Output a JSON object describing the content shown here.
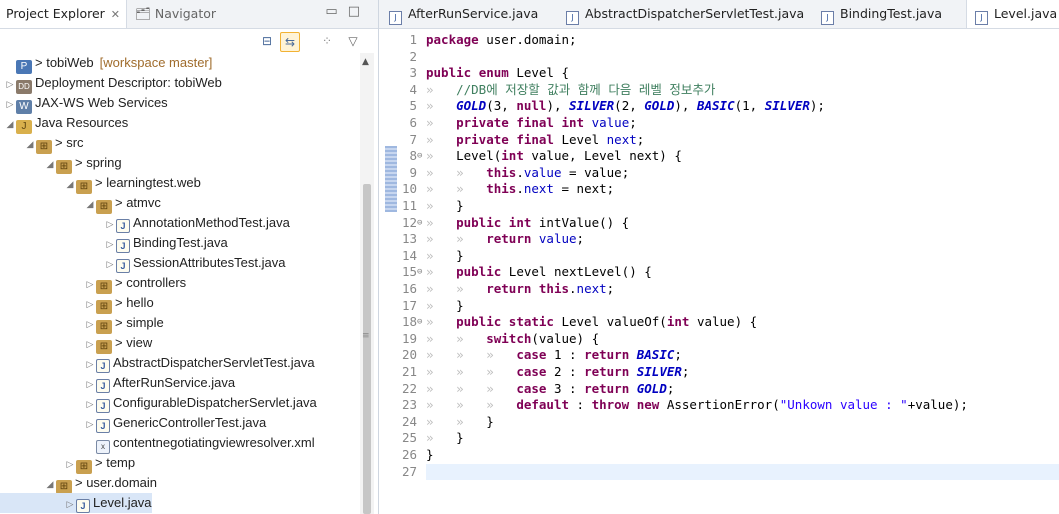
{
  "left_panel": {
    "tab_active": "Project Explorer",
    "tab_inactive": "Navigator",
    "tree": [
      {
        "indent": 0,
        "twisty": "",
        "icon": "proj",
        "text": "> tobiWeb",
        "suffix": "[workspace master]"
      },
      {
        "indent": 0,
        "twisty": "▷",
        "icon": "dd",
        "text": "Deployment Descriptor: tobiWeb"
      },
      {
        "indent": 0,
        "twisty": "▷",
        "icon": "ws",
        "text": "JAX-WS Web Services"
      },
      {
        "indent": 0,
        "twisty": "◢",
        "icon": "jr",
        "text": "Java Resources"
      },
      {
        "indent": 1,
        "twisty": "◢",
        "icon": "pkg",
        "text": "> src"
      },
      {
        "indent": 2,
        "twisty": "◢",
        "icon": "pkg",
        "text": "> spring"
      },
      {
        "indent": 3,
        "twisty": "◢",
        "icon": "pkg",
        "text": "> learningtest.web"
      },
      {
        "indent": 4,
        "twisty": "◢",
        "icon": "pkg",
        "text": "> atmvc"
      },
      {
        "indent": 5,
        "twisty": "▷",
        "icon": "java",
        "text": "AnnotationMethodTest.java"
      },
      {
        "indent": 5,
        "twisty": "▷",
        "icon": "java",
        "text": "BindingTest.java"
      },
      {
        "indent": 5,
        "twisty": "▷",
        "icon": "java",
        "text": "SessionAttributesTest.java"
      },
      {
        "indent": 4,
        "twisty": "▷",
        "icon": "pkg",
        "text": "> controllers"
      },
      {
        "indent": 4,
        "twisty": "▷",
        "icon": "pkg",
        "text": "> hello"
      },
      {
        "indent": 4,
        "twisty": "▷",
        "icon": "pkg",
        "text": "> simple"
      },
      {
        "indent": 4,
        "twisty": "▷",
        "icon": "pkg",
        "text": "> view"
      },
      {
        "indent": 4,
        "twisty": "▷",
        "icon": "java",
        "text": "AbstractDispatcherServletTest.java"
      },
      {
        "indent": 4,
        "twisty": "▷",
        "icon": "java",
        "text": "AfterRunService.java"
      },
      {
        "indent": 4,
        "twisty": "▷",
        "icon": "java",
        "text": "ConfigurableDispatcherServlet.java"
      },
      {
        "indent": 4,
        "twisty": "▷",
        "icon": "java",
        "text": "GenericControllerTest.java"
      },
      {
        "indent": 4,
        "twisty": "",
        "icon": "xml",
        "text": "contentnegotiatingviewresolver.xml"
      },
      {
        "indent": 3,
        "twisty": "▷",
        "icon": "pkg",
        "text": "> temp"
      },
      {
        "indent": 2,
        "twisty": "◢",
        "icon": "pkg",
        "text": "> user.domain"
      },
      {
        "indent": 3,
        "twisty": "▷",
        "icon": "java",
        "text": "Level.java",
        "selected": true
      }
    ]
  },
  "editor": {
    "tabs": [
      "AfterRunService.java",
      "AbstractDispatcherServletTest.java",
      "BindingTest.java",
      "Level.java"
    ],
    "lines": [
      {
        "n": "1",
        "fold": "",
        "html": "<span class='kw'>package</span> user.domain;"
      },
      {
        "n": "2",
        "fold": "",
        "html": ""
      },
      {
        "n": "3",
        "fold": "",
        "html": "<span class='kw'>public</span> <span class='kw'>enum</span> Level {"
      },
      {
        "n": "4",
        "fold": "",
        "html": "<span class='ws'>»   </span><span class='cm'>//DB에 저장할 값과 함께 다음 레벨 정보추가</span>"
      },
      {
        "n": "5",
        "fold": "",
        "html": "<span class='ws'>»   </span><span class='en'>GOLD</span>(3, <span class='kw'>null</span>), <span class='en'>SILVER</span>(2, <span class='en'>GOLD</span>), <span class='en'>BASIC</span>(1, <span class='en'>SILVER</span>);"
      },
      {
        "n": "6",
        "fold": "",
        "html": "<span class='ws'>»   </span><span class='kw'>private</span> <span class='kw'>final</span> <span class='kw'>int</span> <span class='fld'>value</span>;"
      },
      {
        "n": "7",
        "fold": "",
        "html": "<span class='ws'>»   </span><span class='kw'>private</span> <span class='kw'>final</span> Level <span class='fld'>next</span>;"
      },
      {
        "n": "8",
        "fold": "⊖",
        "html": "<span class='ws'>»   </span>Level(<span class='kw'>int</span> value, Level next) {"
      },
      {
        "n": "9",
        "fold": "",
        "html": "<span class='ws'>»   »   </span><span class='kw'>this</span>.<span class='fld'>value</span> = value;"
      },
      {
        "n": "10",
        "fold": "",
        "html": "<span class='ws'>»   »   </span><span class='kw'>this</span>.<span class='fld'>next</span> = next;"
      },
      {
        "n": "11",
        "fold": "",
        "html": "<span class='ws'>»   </span>}"
      },
      {
        "n": "12",
        "fold": "⊖",
        "html": "<span class='ws'>»   </span><span class='kw'>public</span> <span class='kw'>int</span> intValue() {"
      },
      {
        "n": "13",
        "fold": "",
        "html": "<span class='ws'>»   »   </span><span class='kw'>return</span> <span class='fld'>value</span>;"
      },
      {
        "n": "14",
        "fold": "",
        "html": "<span class='ws'>»   </span>}"
      },
      {
        "n": "15",
        "fold": "⊖",
        "html": "<span class='ws'>»   </span><span class='kw'>public</span> Level nextLevel() {"
      },
      {
        "n": "16",
        "fold": "",
        "html": "<span class='ws'>»   »   </span><span class='kw'>return</span> <span class='kw'>this</span>.<span class='fld'>next</span>;"
      },
      {
        "n": "17",
        "fold": "",
        "html": "<span class='ws'>»   </span>}"
      },
      {
        "n": "18",
        "fold": "⊖",
        "html": "<span class='ws'>»   </span><span class='kw'>public</span> <span class='kw'>static</span> Level valueOf(<span class='kw'>int</span> value) {"
      },
      {
        "n": "19",
        "fold": "",
        "html": "<span class='ws'>»   »   </span><span class='kw'>switch</span>(value) {"
      },
      {
        "n": "20",
        "fold": "",
        "html": "<span class='ws'>»   »   »   </span><span class='kw'>case</span> 1 : <span class='kw'>return</span> <span class='en'>BASIC</span>;"
      },
      {
        "n": "21",
        "fold": "",
        "html": "<span class='ws'>»   »   »   </span><span class='kw'>case</span> 2 : <span class='kw'>return</span> <span class='en'>SILVER</span>;"
      },
      {
        "n": "22",
        "fold": "",
        "html": "<span class='ws'>»   »   »   </span><span class='kw'>case</span> 3 : <span class='kw'>return</span> <span class='en'>GOLD</span>;"
      },
      {
        "n": "23",
        "fold": "",
        "html": "<span class='ws'>»   »   »   </span><span class='kw'>default</span> : <span class='kw'>throw</span> <span class='kw'>new</span> AssertionError(<span class='st'>\"Unkown value : \"</span>+value);"
      },
      {
        "n": "24",
        "fold": "",
        "html": "<span class='ws'>»   »   </span>}"
      },
      {
        "n": "25",
        "fold": "",
        "html": "<span class='ws'>»   </span>}"
      },
      {
        "n": "26",
        "fold": "",
        "html": "}"
      },
      {
        "n": "27",
        "fold": "",
        "html": ""
      }
    ]
  }
}
